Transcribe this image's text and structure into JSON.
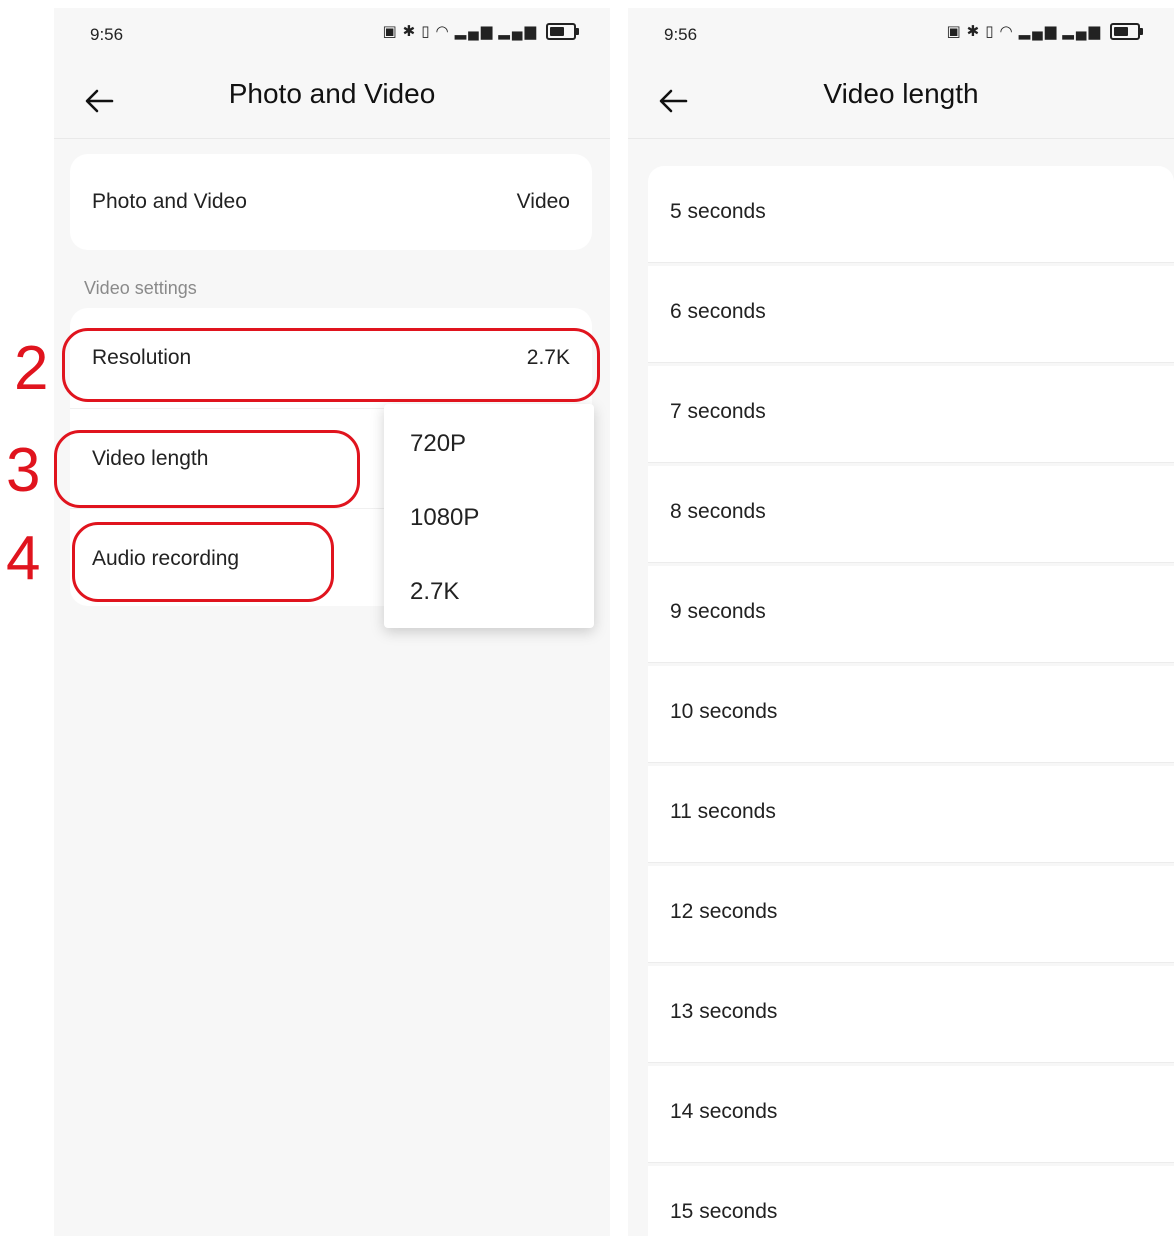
{
  "left_screen": {
    "status_time": "9:56",
    "title": "Photo and Video",
    "mode_row": {
      "label": "Photo and Video",
      "value": "Video"
    },
    "section_title": "Video settings",
    "resolution_row": {
      "label": "Resolution",
      "value": "2.7K"
    },
    "video_length_row": {
      "label": "Video length"
    },
    "audio_row": {
      "label": "Audio recording"
    },
    "resolution_menu": [
      "720P",
      "1080P",
      "2.7K"
    ],
    "annotations": [
      "2",
      "3",
      "4"
    ]
  },
  "right_screen": {
    "status_time": "9:56",
    "title": "Video length",
    "options": [
      "5 seconds",
      "6 seconds",
      "7 seconds",
      "8 seconds",
      "9 seconds",
      "10 seconds",
      "11 seconds",
      "12 seconds",
      "13 seconds",
      "14 seconds",
      "15 seconds"
    ]
  },
  "colors": {
    "annotation_red": "#e0141e",
    "background": "#f7f7f7",
    "card": "#ffffff"
  },
  "icons": [
    "back-arrow-icon",
    "nfc-icon",
    "bluetooth-icon",
    "vibrate-icon",
    "wifi-icon",
    "signal-icon",
    "battery-icon"
  ]
}
